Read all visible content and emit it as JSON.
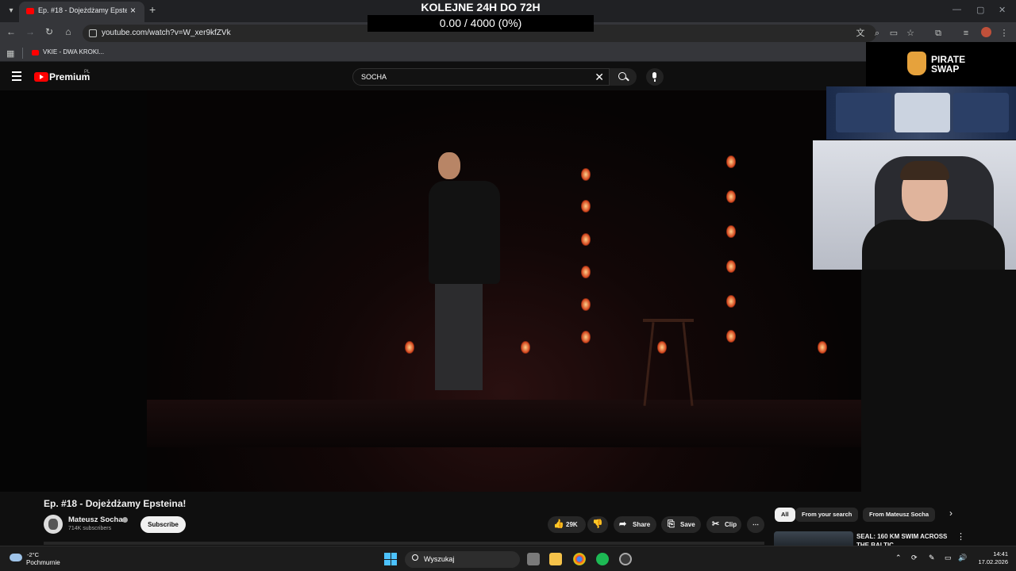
{
  "browser": {
    "tab_title": "Ep. #18 - Dojeżdżamy Epsteina!",
    "url": "youtube.com/watch?v=W_xer9kfZVk",
    "bookmark_label": "VKIE - DWA KROKI..."
  },
  "overlay": {
    "title": "KOLEJNE 24H DO 72H",
    "progress_text": "0.00 / 4000 (0%)",
    "progress_value": 0,
    "sponsor_name": "PIRATE SWAP"
  },
  "youtube": {
    "brand": "Premium",
    "region": "PL",
    "search_value": "SOCHA"
  },
  "video": {
    "title": "Ep. #18 - Dojeżdżamy Epsteina!",
    "channel": "Mateusz Socha",
    "subscribers": "714K subscribers",
    "subscribe_label": "Subscribe",
    "likes": "29K",
    "share_label": "Share",
    "save_label": "Save",
    "clip_label": "Clip"
  },
  "sidebar": {
    "chips": [
      "All",
      "From your search",
      "From Mateusz Socha"
    ],
    "recommendation_title": "SEAL: 160 KM SWIM ACROSS THE BALTIC"
  },
  "taskbar": {
    "temperature": "-2°C",
    "weather": "Pochmurnie",
    "search_label": "Wyszukaj",
    "time": "14:41",
    "date": "17.02.2026"
  },
  "colors": {
    "youtube_red": "#ff0000",
    "page_bg": "#0f0f0f",
    "windows_accent": "#4cc2ff"
  }
}
